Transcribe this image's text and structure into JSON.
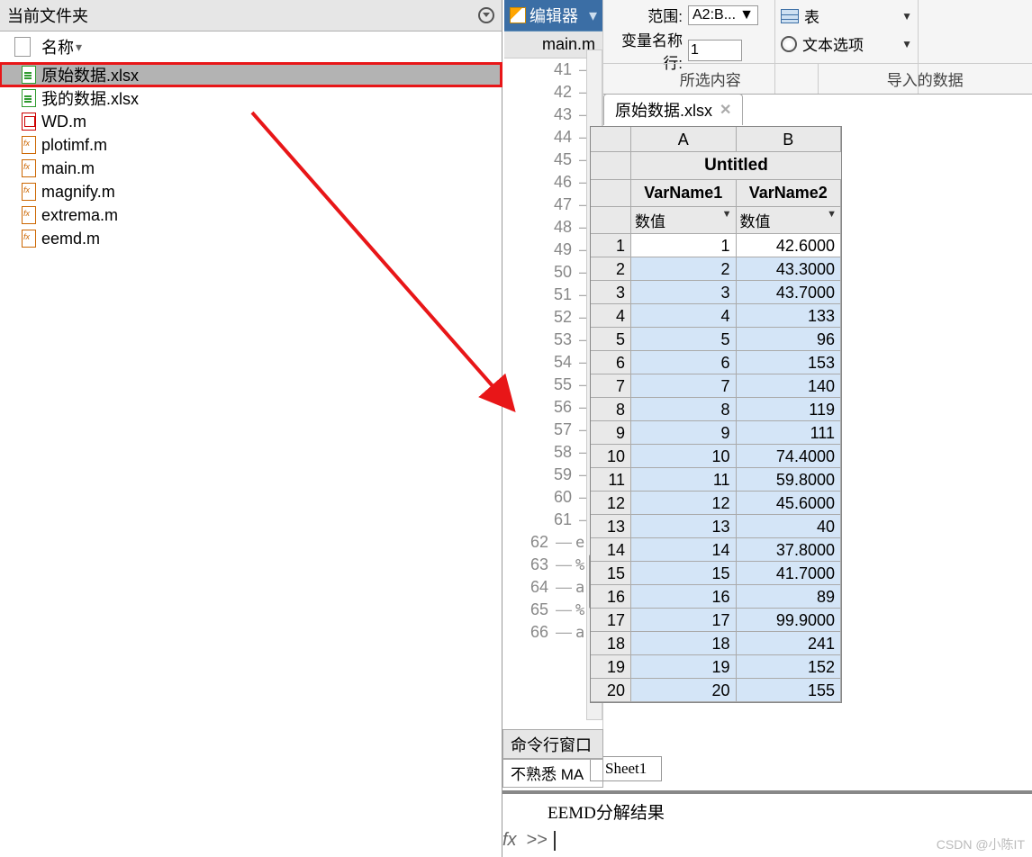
{
  "left_panel": {
    "title": "当前文件夹",
    "header": "名称",
    "files": [
      {
        "name": "原始数据.xlsx",
        "type": "xlsx",
        "selected": true,
        "highlight": true
      },
      {
        "name": "我的数据.xlsx",
        "type": "xlsx"
      },
      {
        "name": "WD.m",
        "type": "wd"
      },
      {
        "name": "plotimf.m",
        "type": "m"
      },
      {
        "name": "main.m",
        "type": "m"
      },
      {
        "name": "magnify.m",
        "type": "m"
      },
      {
        "name": "extrema.m",
        "type": "m"
      },
      {
        "name": "eemd.m",
        "type": "m"
      }
    ]
  },
  "editor": {
    "title": "编辑器",
    "tab": "main.m",
    "lines": [
      41,
      42,
      43,
      44,
      45,
      46,
      47,
      48,
      49,
      50,
      51,
      52,
      53,
      54,
      55,
      56,
      57,
      58,
      59,
      60,
      61,
      62,
      63,
      64,
      65,
      66
    ],
    "fold_lines": [
      51,
      56
    ],
    "extras": {
      "62": "e",
      "63": "%",
      "64": "a",
      "65": "%",
      "66": "a"
    }
  },
  "import": {
    "range_label": "范围:",
    "range_value": "A2:B...",
    "varrow_label": "变量名称行:",
    "varrow_value": "1",
    "table_label": "表",
    "text_label": "文本选项",
    "section_sel": "所选内容",
    "section_imp": "导入的数据"
  },
  "data_tab": {
    "name": "原始数据.xlsx"
  },
  "grid": {
    "title": "Untitled",
    "cols": [
      "A",
      "B"
    ],
    "varnames": [
      "VarName1",
      "VarName2"
    ],
    "coltype": "数值",
    "rows": [
      {
        "n": 1,
        "a": "1",
        "b": "42.6000",
        "first": true
      },
      {
        "n": 2,
        "a": "2",
        "b": "43.3000"
      },
      {
        "n": 3,
        "a": "3",
        "b": "43.7000"
      },
      {
        "n": 4,
        "a": "4",
        "b": "133"
      },
      {
        "n": 5,
        "a": "5",
        "b": "96"
      },
      {
        "n": 6,
        "a": "6",
        "b": "153"
      },
      {
        "n": 7,
        "a": "7",
        "b": "140"
      },
      {
        "n": 8,
        "a": "8",
        "b": "119"
      },
      {
        "n": 9,
        "a": "9",
        "b": "111"
      },
      {
        "n": 10,
        "a": "10",
        "b": "74.4000"
      },
      {
        "n": 11,
        "a": "11",
        "b": "59.8000"
      },
      {
        "n": 12,
        "a": "12",
        "b": "45.6000"
      },
      {
        "n": 13,
        "a": "13",
        "b": "40"
      },
      {
        "n": 14,
        "a": "14",
        "b": "37.8000"
      },
      {
        "n": 15,
        "a": "15",
        "b": "41.7000"
      },
      {
        "n": 16,
        "a": "16",
        "b": "89"
      },
      {
        "n": 17,
        "a": "17",
        "b": "99.9000"
      },
      {
        "n": 18,
        "a": "18",
        "b": "241"
      },
      {
        "n": 19,
        "a": "19",
        "b": "152"
      },
      {
        "n": 20,
        "a": "20",
        "b": "155"
      }
    ]
  },
  "sheet_tab": "Sheet1",
  "cmd": {
    "title": "命令行窗口",
    "sub": "不熟悉 MA"
  },
  "bottom": {
    "eemd": "EEMD分解结果",
    "fx": "fx",
    "prompt": ">>"
  },
  "watermark": "CSDN @小陈IT"
}
